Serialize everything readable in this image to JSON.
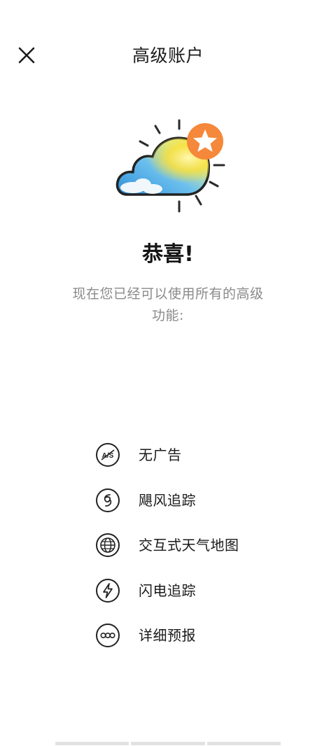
{
  "header": {
    "title": "高级账户"
  },
  "main": {
    "congrats": "恭喜!",
    "description": "现在您已经可以使用所有的高级功能:"
  },
  "features": [
    {
      "icon": "no-ads-icon",
      "label": "无广告"
    },
    {
      "icon": "hurricane-icon",
      "label": "飓风追踪"
    },
    {
      "icon": "globe-icon",
      "label": "交互式天气地图"
    },
    {
      "icon": "lightning-icon",
      "label": "闪电追踪"
    },
    {
      "icon": "detail-forecast-icon",
      "label": "详细预报"
    }
  ],
  "colors": {
    "accent_orange": "#f5883a",
    "sky_blue": "#3a9ee0",
    "sun_yellow": "#fbe84a",
    "text_gray": "#8a8a8a"
  }
}
